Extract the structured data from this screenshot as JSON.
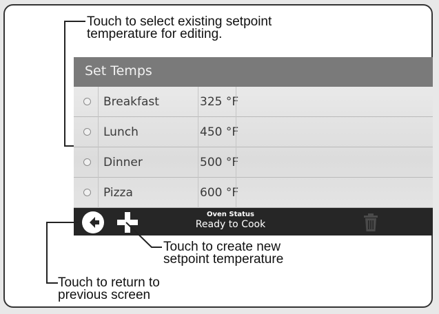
{
  "callouts": {
    "select": "Touch to select existing setpoint\ntemperature for editing.",
    "create": "Touch to create new\nsetpoint temperature",
    "back": "Touch to return to\nprevious screen"
  },
  "screen": {
    "title": "Set Temps",
    "setpoints": [
      {
        "name": "Breakfast",
        "temp": "325 °F"
      },
      {
        "name": "Lunch",
        "temp": "450 °F"
      },
      {
        "name": "Dinner",
        "temp": "500 °F"
      },
      {
        "name": "Pizza",
        "temp": "600 °F"
      }
    ],
    "status_label": "Oven Status",
    "status_value": "Ready to Cook"
  },
  "icons": {
    "back": "back-arrow-circle-icon",
    "add": "plus-icon",
    "delete": "trash-icon",
    "row_select": "radio-icon"
  },
  "colors": {
    "title_bar": "#7a7a7a",
    "bottom_bar": "#262626",
    "list_background": "#e2e2e2"
  }
}
